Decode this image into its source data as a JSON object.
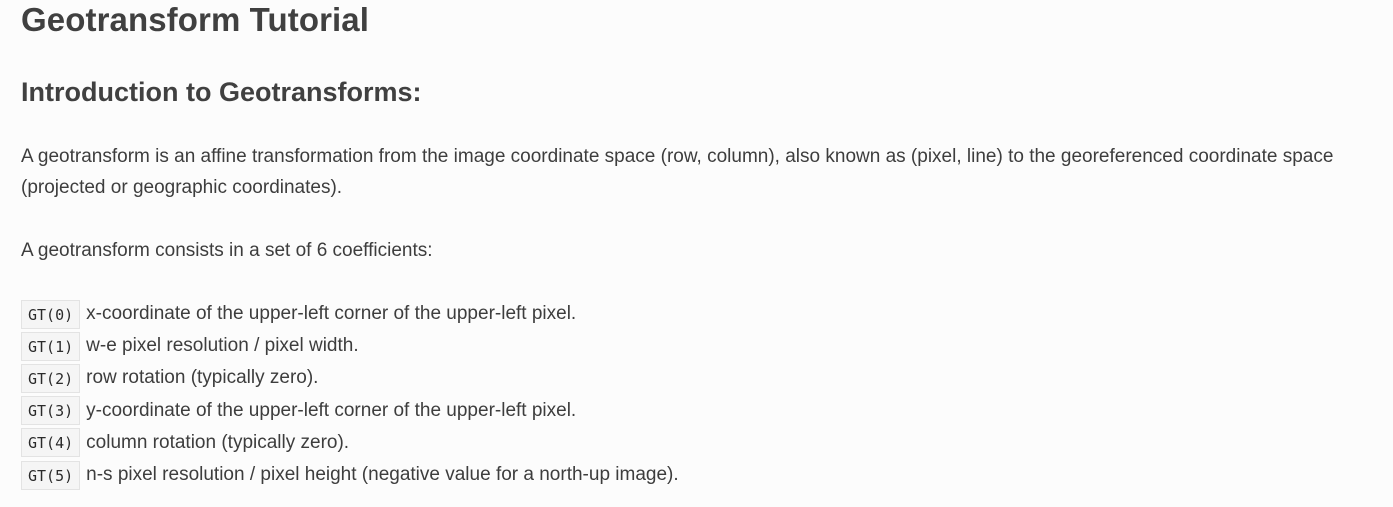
{
  "page": {
    "title": "Geotransform Tutorial"
  },
  "section": {
    "title": "Introduction to Geotransforms:"
  },
  "intro": {
    "paragraph": "A geotransform is an affine transformation from the image coordinate space (row, column), also known as (pixel, line) to the georeferenced coordinate space (projected or geographic coordinates).",
    "count_text": "A geotransform consists in a set of 6 coefficients:"
  },
  "coefficients": [
    {
      "code": "GT(0)",
      "description": "x-coordinate of the upper-left corner of the upper-left pixel."
    },
    {
      "code": "GT(1)",
      "description": "w-e pixel resolution / pixel width."
    },
    {
      "code": "GT(2)",
      "description": "row rotation (typically zero)."
    },
    {
      "code": "GT(3)",
      "description": "y-coordinate of the upper-left corner of the upper-left pixel."
    },
    {
      "code": "GT(4)",
      "description": "column rotation (typically zero)."
    },
    {
      "code": "GT(5)",
      "description": "n-s pixel resolution / pixel height (negative value for a north-up image)."
    }
  ]
}
